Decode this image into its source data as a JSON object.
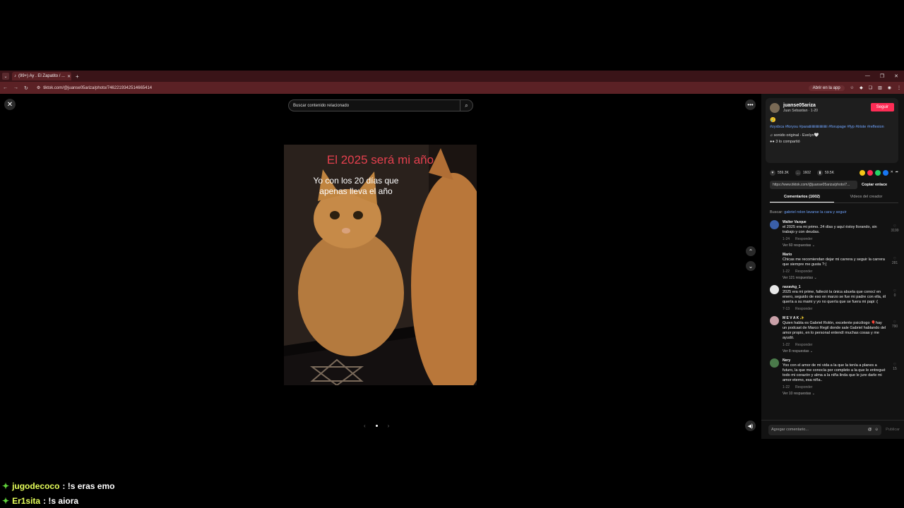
{
  "browser": {
    "tabs": [
      {
        "label": "(99+) Ay . El Zapatito / ..."
      }
    ],
    "url": "tiktok.com/@juanse05ariza/photo/7462219342514665414",
    "open_app_label": "Abrir en la app"
  },
  "page": {
    "search_placeholder": "Buscar contenido relacionado",
    "photo": {
      "caption_title": "El 2025 será mi año",
      "caption_text": "Yo con los 20 días que apenas lleva el año"
    }
  },
  "sidebar": {
    "author": {
      "username": "juanse05ariza",
      "subtitle": "Juan Sebastian · 1-20",
      "follow_label": "Seguir"
    },
    "emoji": "🥲",
    "hashtags": "#zyxbca #foryou #paratiiiiiiiiiiiiiiiiiiii #forupage #fyp #triste #reflexion",
    "sound": "sonido original - Evelyn🤍",
    "shared": "3 lo compartió",
    "stats": {
      "likes": "559.3K",
      "comments": "1602",
      "saves": "59.5K"
    },
    "link": "https://www.tiktok.com/@juanse05ariza/photo/7...",
    "copy_label": "Copiar enlace",
    "tabs": [
      "Comentarios (1602)",
      "Videos del creador"
    ],
    "search_hint_prefix": "Buscar:",
    "search_hint_query": "gabriel rolon lavarse la cara y seguir",
    "comments": [
      {
        "user": "Walter Vazque",
        "text": "el 2025 era mi primo. 24 días y aquí éstoy llorando, sin trabajo y con deudas.",
        "date": "1-24",
        "reply": "Responder",
        "replies": "Ver 60 respuestas ⌄",
        "likes": "3199",
        "color": "#3a5fa8"
      },
      {
        "user": "Mario",
        "text": "Chicas me recomiendan dejar mi carrera y seguir la carrera que siempre me gusta ?:(",
        "date": "1-22",
        "reply": "Responder",
        "replies": "Ver 121 respuestas ⌄",
        "likes": "281",
        "color": "#121212"
      },
      {
        "user": "naxavkg_1",
        "text": "2025 era mi prime, falleció la única abuela que conocí en enero, seguido de eso en marzo se fue mi padre con ella, él quería a su mami y yo no quería que se fuera mi papi :(",
        "date": "7-13",
        "reply": "Responder",
        "replies": "",
        "likes": "0",
        "color": "#e8e8e8"
      },
      {
        "user": "M E V A K ✨",
        "text": "Quien habla es Gabriel Rolón, excelente psicólogo 🎈hay un podcast de Marco Regil donde sale Gabriel hablando del amor propio, en lo personal entendí muchas cosas y me ayudó.",
        "date": "1-22",
        "reply": "Responder",
        "replies": "Ver 8 respuestas ⌄",
        "likes": "790",
        "color": "#c9a0a8"
      },
      {
        "user": "Nery",
        "text": "Yoo con el amor de mi vida a la que la tenía a planes a futuro, la que me conocía por completo a la que le entregué todo mi corazón y alma a la niña linda que le jure darle mi amor eterno, esa niña..",
        "date": "1-22",
        "reply": "Responder",
        "replies": "Ver 10 respuestas ⌄",
        "likes": "15",
        "color": "#4a7a4a"
      }
    ],
    "comment_placeholder": "Agregar comentario...",
    "post_label": "Publicar"
  },
  "chat": [
    {
      "name": "jugodecoco",
      "message": ": !s eras emo"
    },
    {
      "name": "Er1sita",
      "message": ": !s aiora"
    }
  ]
}
